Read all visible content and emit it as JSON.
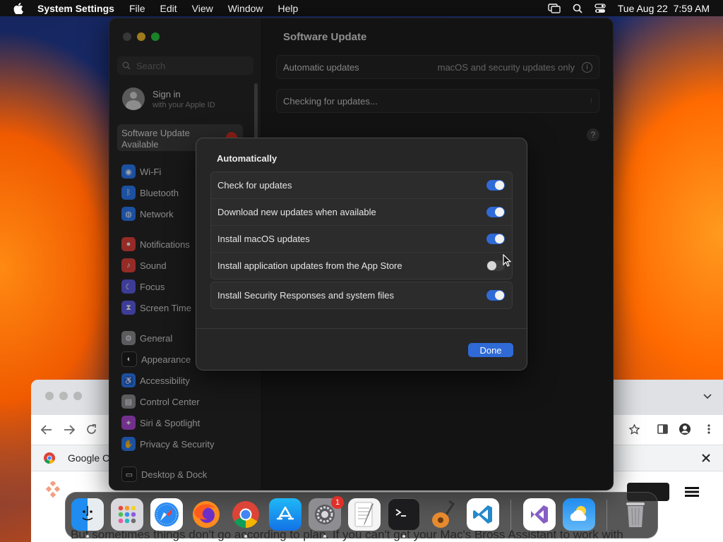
{
  "menubar": {
    "app": "System Settings",
    "items": [
      "File",
      "Edit",
      "View",
      "Window",
      "Help"
    ],
    "datetime": "Tue Aug 22  7:59 AM"
  },
  "sidebar": {
    "search_placeholder": "Search",
    "signin_title": "Sign in",
    "signin_subtitle": "with your Apple ID",
    "update_item": "Software Update Available",
    "items": [
      {
        "label": "Wi-Fi",
        "icon": "wifi-icon",
        "color": "#2c7cf6"
      },
      {
        "label": "Bluetooth",
        "icon": "bluetooth-icon",
        "color": "#2c7cf6"
      },
      {
        "label": "Network",
        "icon": "network-icon",
        "color": "#2c7cf6"
      },
      {
        "label": "Notifications",
        "icon": "notifications-icon",
        "color": "#e5423b"
      },
      {
        "label": "Sound",
        "icon": "sound-icon",
        "color": "#e5423b"
      },
      {
        "label": "Focus",
        "icon": "focus-icon",
        "color": "#5e5ce6"
      },
      {
        "label": "Screen Time",
        "icon": "screen-time-icon",
        "color": "#5e5ce6"
      },
      {
        "label": "General",
        "icon": "general-icon",
        "color": "#8e8e93"
      },
      {
        "label": "Appearance",
        "icon": "appearance-icon",
        "color": "#1c1c1e"
      },
      {
        "label": "Accessibility",
        "icon": "accessibility-icon",
        "color": "#2c7cf6"
      },
      {
        "label": "Control Center",
        "icon": "control-center-icon",
        "color": "#8e8e93"
      },
      {
        "label": "Siri & Spotlight",
        "icon": "siri-icon",
        "color": "#b04ad8"
      },
      {
        "label": "Privacy & Security",
        "icon": "privacy-icon",
        "color": "#2c7cf6"
      },
      {
        "label": "Desktop & Dock",
        "icon": "desktop-dock-icon",
        "color": "#1c1c1e"
      }
    ]
  },
  "main": {
    "title": "Software Update",
    "automatic_label": "Automatic updates",
    "automatic_value": "macOS and security updates only",
    "checking": "Checking for updates..."
  },
  "sheet": {
    "heading": "Automatically",
    "options": [
      {
        "label": "Check for updates",
        "on": true
      },
      {
        "label": "Download new updates when available",
        "on": true
      },
      {
        "label": "Install macOS updates",
        "on": true
      },
      {
        "label": "Install application updates from the App Store",
        "on": false
      }
    ],
    "security": {
      "label": "Install Security Responses and system files",
      "on": true
    },
    "done": "Done"
  },
  "browser": {
    "tab_title": "Google C",
    "body_text": "But sometimes things don't go according to plan. If you can't get your Mac's Bross Assistant to work with"
  },
  "dock": {
    "apps": [
      "Finder",
      "Launchpad",
      "Safari",
      "Firefox",
      "Chrome",
      "App Store",
      "System Settings",
      "TextEdit",
      "Terminal",
      "GarageBand",
      "Visual Studio Code",
      "Visual Studio",
      "Weather",
      "Trash"
    ],
    "settings_badge": "1"
  }
}
